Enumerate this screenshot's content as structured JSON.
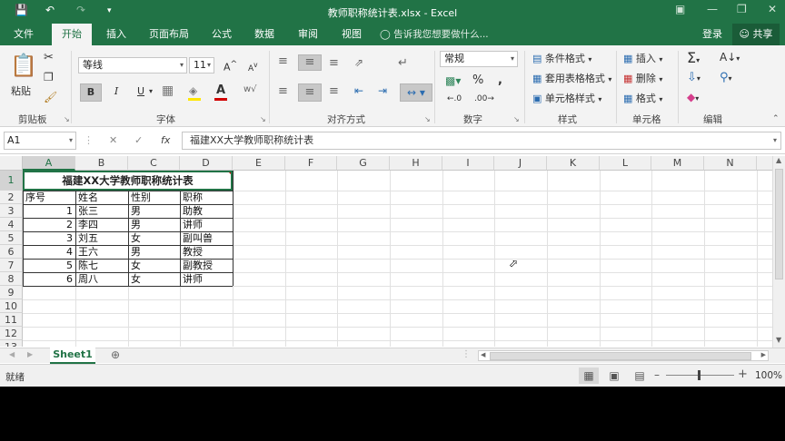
{
  "window": {
    "title": "教师职称统计表.xlsx - Excel"
  },
  "tabs": [
    {
      "label": "文件"
    },
    {
      "label": "开始"
    },
    {
      "label": "插入"
    },
    {
      "label": "页面布局"
    },
    {
      "label": "公式"
    },
    {
      "label": "数据"
    },
    {
      "label": "审阅"
    },
    {
      "label": "视图"
    }
  ],
  "tell_me": "告诉我您想要做什么...",
  "account": {
    "login": "登录",
    "share": "共享"
  },
  "ribbon": {
    "clipboard": {
      "label": "剪贴板",
      "paste": "粘贴"
    },
    "font": {
      "label": "字体",
      "name": "等线",
      "size": "11",
      "bold": "B",
      "italic": "I",
      "underline": "U"
    },
    "alignment": {
      "label": "对齐方式"
    },
    "number": {
      "label": "数字",
      "format": "常规"
    },
    "styles": {
      "label": "样式",
      "conditional": "条件格式",
      "table": "套用表格格式",
      "cell_styles": "单元格样式"
    },
    "cells": {
      "label": "单元格",
      "insert": "插入",
      "delete": "删除",
      "format": "格式"
    },
    "editing": {
      "label": "编辑"
    }
  },
  "formula_bar": {
    "name_box": "A1",
    "fx": "fx",
    "content": "福建XX大学教师职称统计表"
  },
  "columns": [
    "A",
    "B",
    "C",
    "D",
    "E",
    "F",
    "G",
    "H",
    "I",
    "J",
    "K",
    "L",
    "M",
    "N"
  ],
  "rows": [
    "1",
    "2",
    "3",
    "4",
    "5",
    "6",
    "7",
    "8",
    "9",
    "10",
    "11",
    "12",
    "13"
  ],
  "table": {
    "title": "福建XX大学教师职称统计表",
    "headers": [
      "序号",
      "姓名",
      "性别",
      "职称"
    ],
    "records": [
      {
        "no": "1",
        "name": "张三",
        "gender": "男",
        "title": "助教"
      },
      {
        "no": "2",
        "name": "李四",
        "gender": "男",
        "title": "讲师"
      },
      {
        "no": "3",
        "name": "刘五",
        "gender": "女",
        "title": "副叫兽"
      },
      {
        "no": "4",
        "name": "王六",
        "gender": "男",
        "title": "教授"
      },
      {
        "no": "5",
        "name": "陈七",
        "gender": "女",
        "title": "副教授"
      },
      {
        "no": "6",
        "name": "周八",
        "gender": "女",
        "title": "讲师"
      }
    ]
  },
  "sheet_tab": "Sheet1",
  "status": {
    "ready": "就绪",
    "zoom": "100%"
  },
  "colors": {
    "accent": "#217346"
  }
}
